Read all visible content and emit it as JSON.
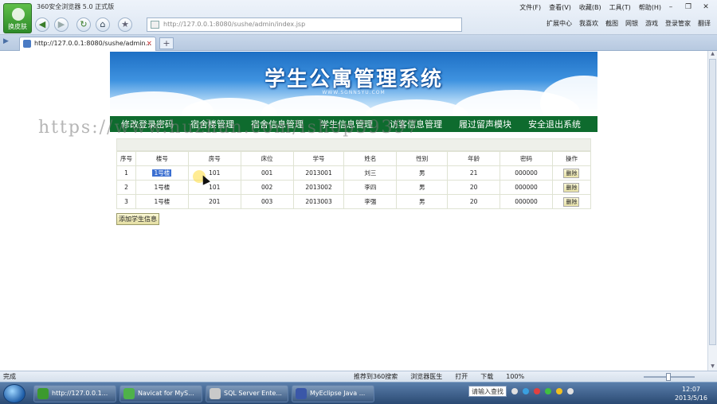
{
  "browser": {
    "window_title": "360安全浏览器 5.0 正式版",
    "logo_label": "换皮肤",
    "menu": [
      "文件(F)",
      "查看(V)",
      "收藏(B)",
      "工具(T)",
      "帮助(H)"
    ],
    "address": "http://127.0.0.1:8080/sushe/admin/index.jsp",
    "toolbar_right": [
      "扩展中心",
      "我喜欢",
      "截图",
      "网银",
      "游戏",
      "登录管家",
      "翻译"
    ],
    "tab_title": "http://127.0.0.1:8080/sushe/admin..."
  },
  "page": {
    "banner_title": "学生公寓管理系统",
    "banner_sub": "WWW.SGNNSYU.COM",
    "nav": [
      "修改登录密码",
      "宿舍楼管理",
      "宿舍信息管理",
      "学生信息管理",
      "访客信息管理",
      "履过留声模块",
      "安全退出系统"
    ],
    "watermark": "https://www.huzhan.com/ishop39397",
    "table": {
      "headers": [
        "序号",
        "楼号",
        "房号",
        "床位",
        "学号",
        "姓名",
        "性别",
        "年龄",
        "密码",
        "操作"
      ],
      "rows": [
        [
          "1",
          "1号楼",
          "101",
          "001",
          "2013001",
          "刘三",
          "男",
          "21",
          "000000",
          "删除"
        ],
        [
          "2",
          "1号楼",
          "101",
          "002",
          "2013002",
          "李四",
          "男",
          "20",
          "000000",
          "删除"
        ],
        [
          "3",
          "1号楼",
          "201",
          "003",
          "2013003",
          "李强",
          "男",
          "20",
          "000000",
          "删除"
        ]
      ]
    },
    "add_button": "添加学生信息"
  },
  "status": {
    "left": "完成",
    "items": [
      "推荐到360搜索",
      "浏览器医生",
      "打开",
      "下载",
      "100%"
    ]
  },
  "taskbar": {
    "tasks": [
      "http://127.0.0.1...",
      "Navicat for MyS...",
      "SQL Server Ente...",
      "MyEclipse Java ..."
    ],
    "ime": "请输入查找",
    "time": "12:07",
    "date": "2013/5/16"
  }
}
